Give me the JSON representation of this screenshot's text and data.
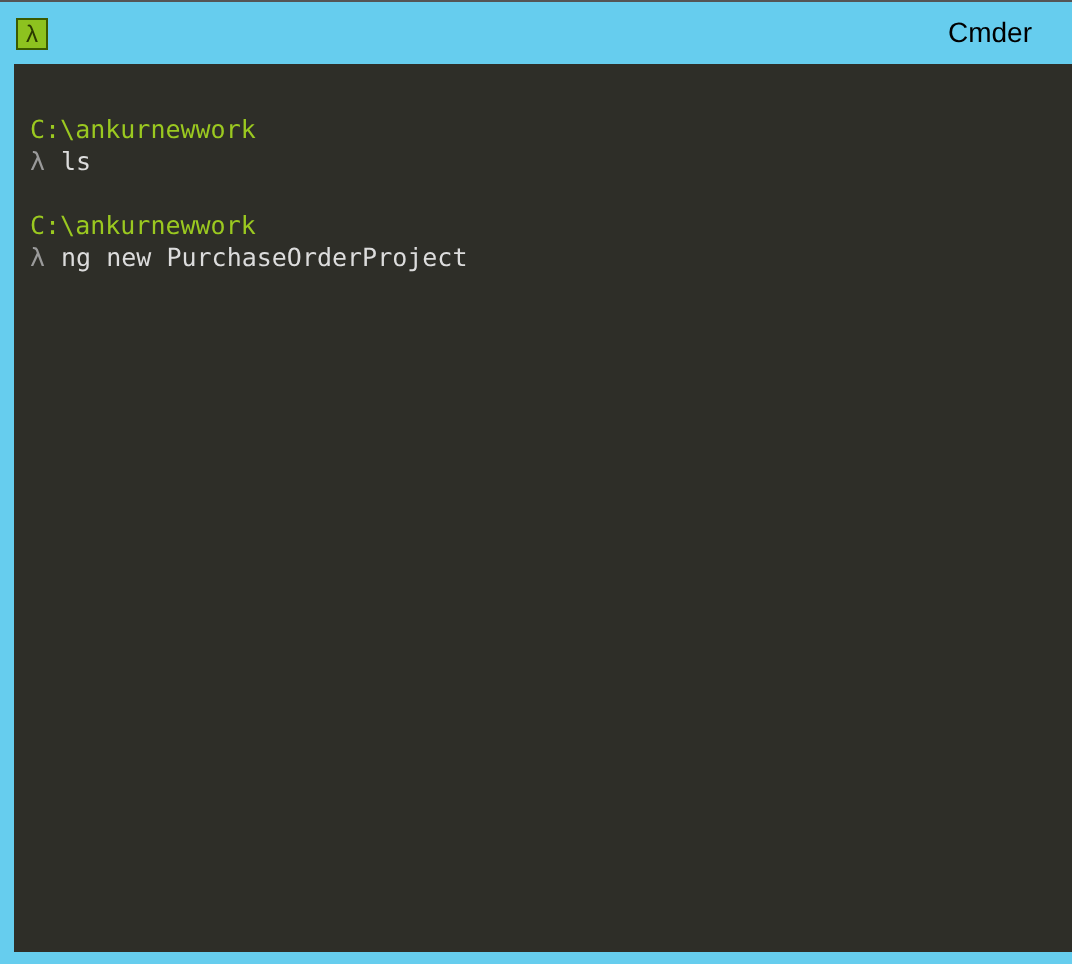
{
  "window": {
    "logo": "λ",
    "title": "Cmder"
  },
  "terminal": {
    "lines": [
      {
        "kind": "path",
        "text": "C:\\ankurnewwork"
      },
      {
        "kind": "command",
        "prompt": "λ",
        "text": "ls"
      },
      {
        "kind": "blank"
      },
      {
        "kind": "path",
        "text": "C:\\ankurnewwork"
      },
      {
        "kind": "command",
        "prompt": "λ",
        "text": "ng new PurchaseOrderProject"
      }
    ]
  }
}
